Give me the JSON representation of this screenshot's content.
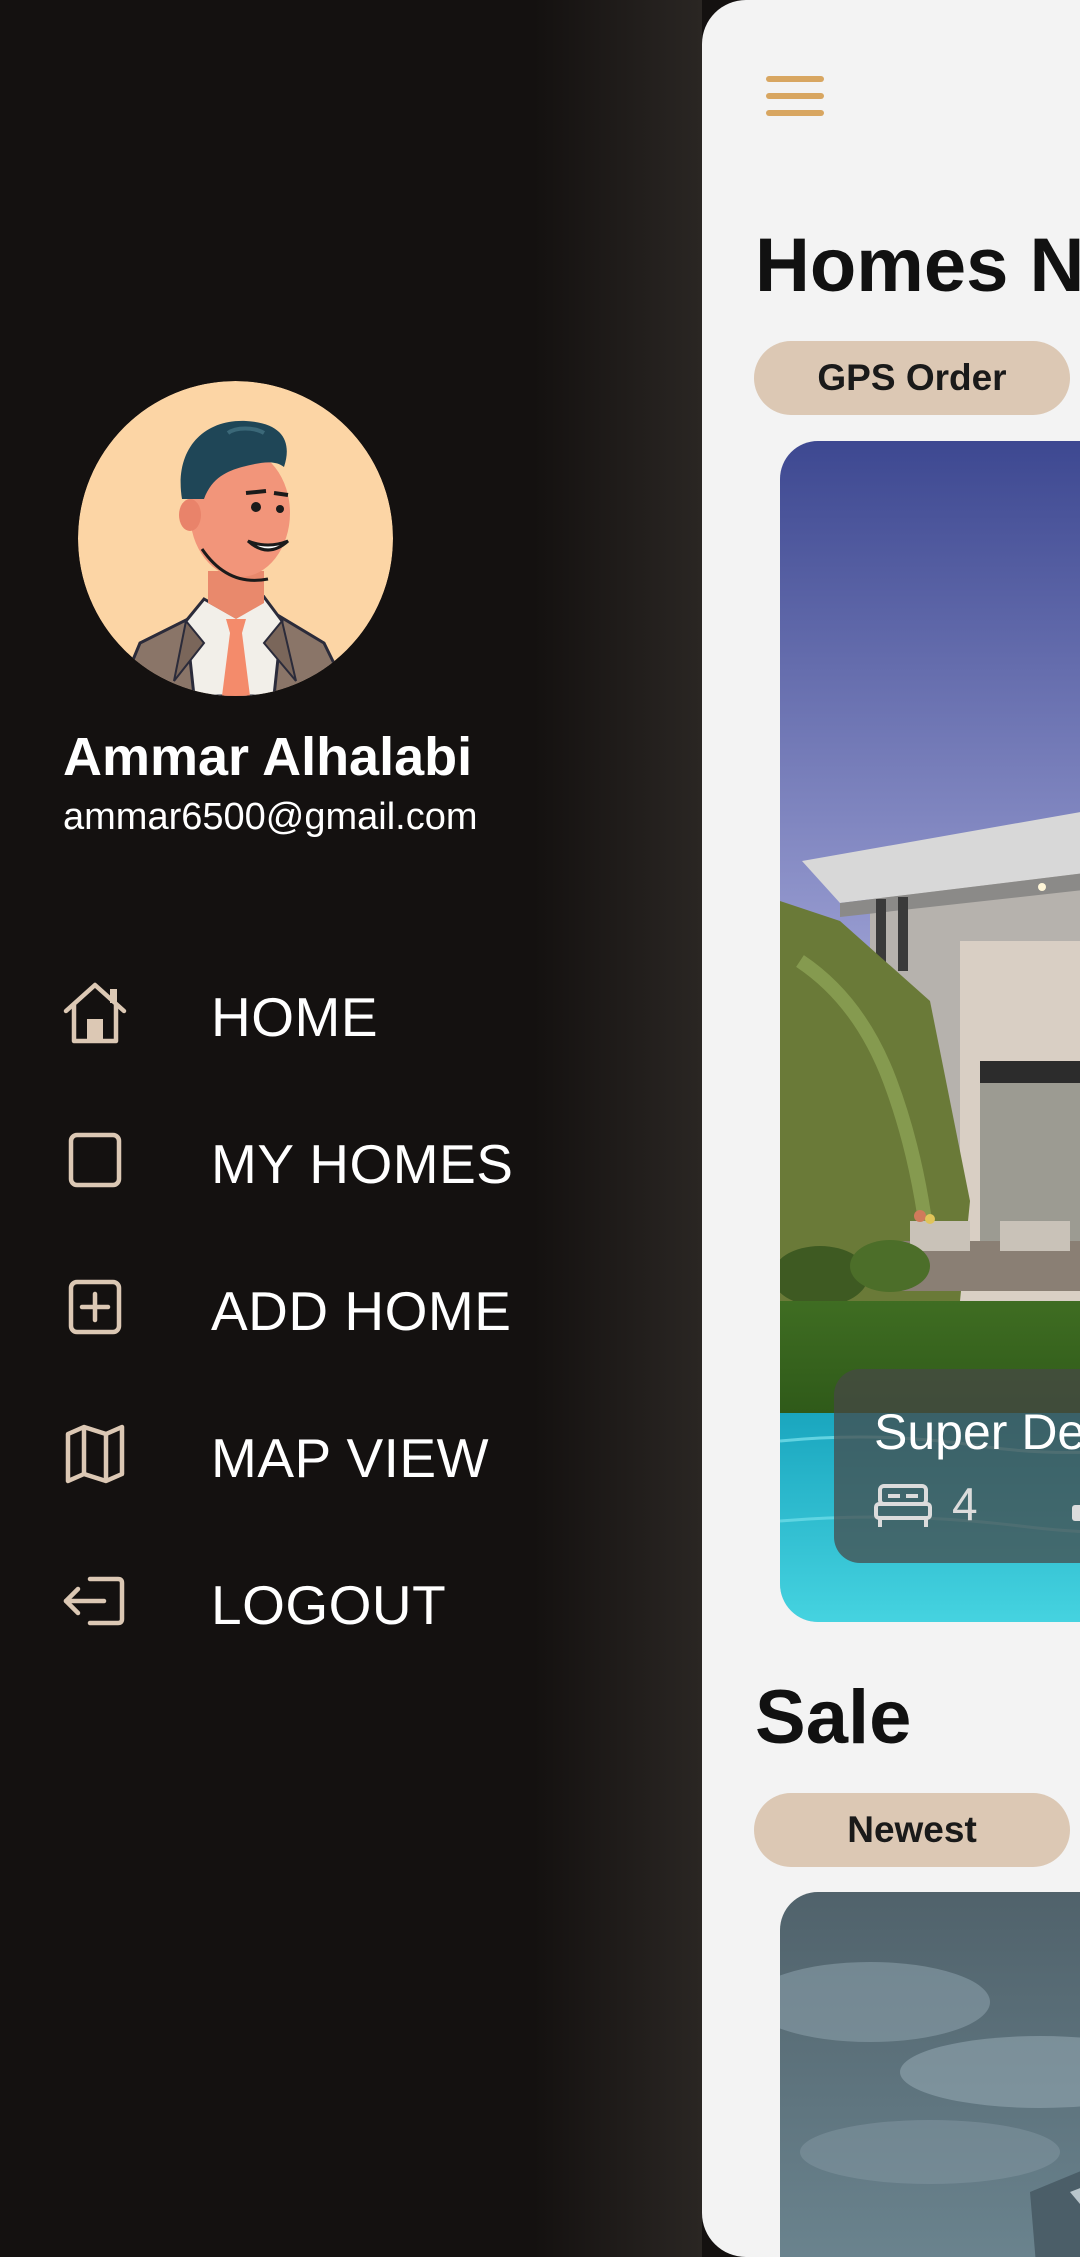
{
  "drawer": {
    "user": {
      "name": "Ammar Alhalabi",
      "email": "ammar6500@gmail.com"
    },
    "menu": [
      {
        "label": "HOME",
        "icon": "home-icon"
      },
      {
        "label": "MY HOMES",
        "icon": "square-icon"
      },
      {
        "label": "ADD HOME",
        "icon": "add-box-icon"
      },
      {
        "label": "MAP VIEW",
        "icon": "map-icon"
      },
      {
        "label": "LOGOUT",
        "icon": "logout-icon"
      }
    ],
    "icon_color": "#dcc8b4",
    "background": "#141110"
  },
  "main": {
    "menu_icon": "hamburger-menu-icon",
    "menu_icon_color": "#d8a661",
    "sections": [
      {
        "title": "Homes N",
        "filter_chip": "GPS Order",
        "card": {
          "title": "Super De",
          "bedrooms": "4",
          "bed_icon": "bed-icon",
          "bath_icon": "bath-icon"
        }
      },
      {
        "title": "Sale",
        "filter_chip": "Newest"
      }
    ],
    "chip_color": "#dcc8b4",
    "background": "#f3f3f3"
  }
}
